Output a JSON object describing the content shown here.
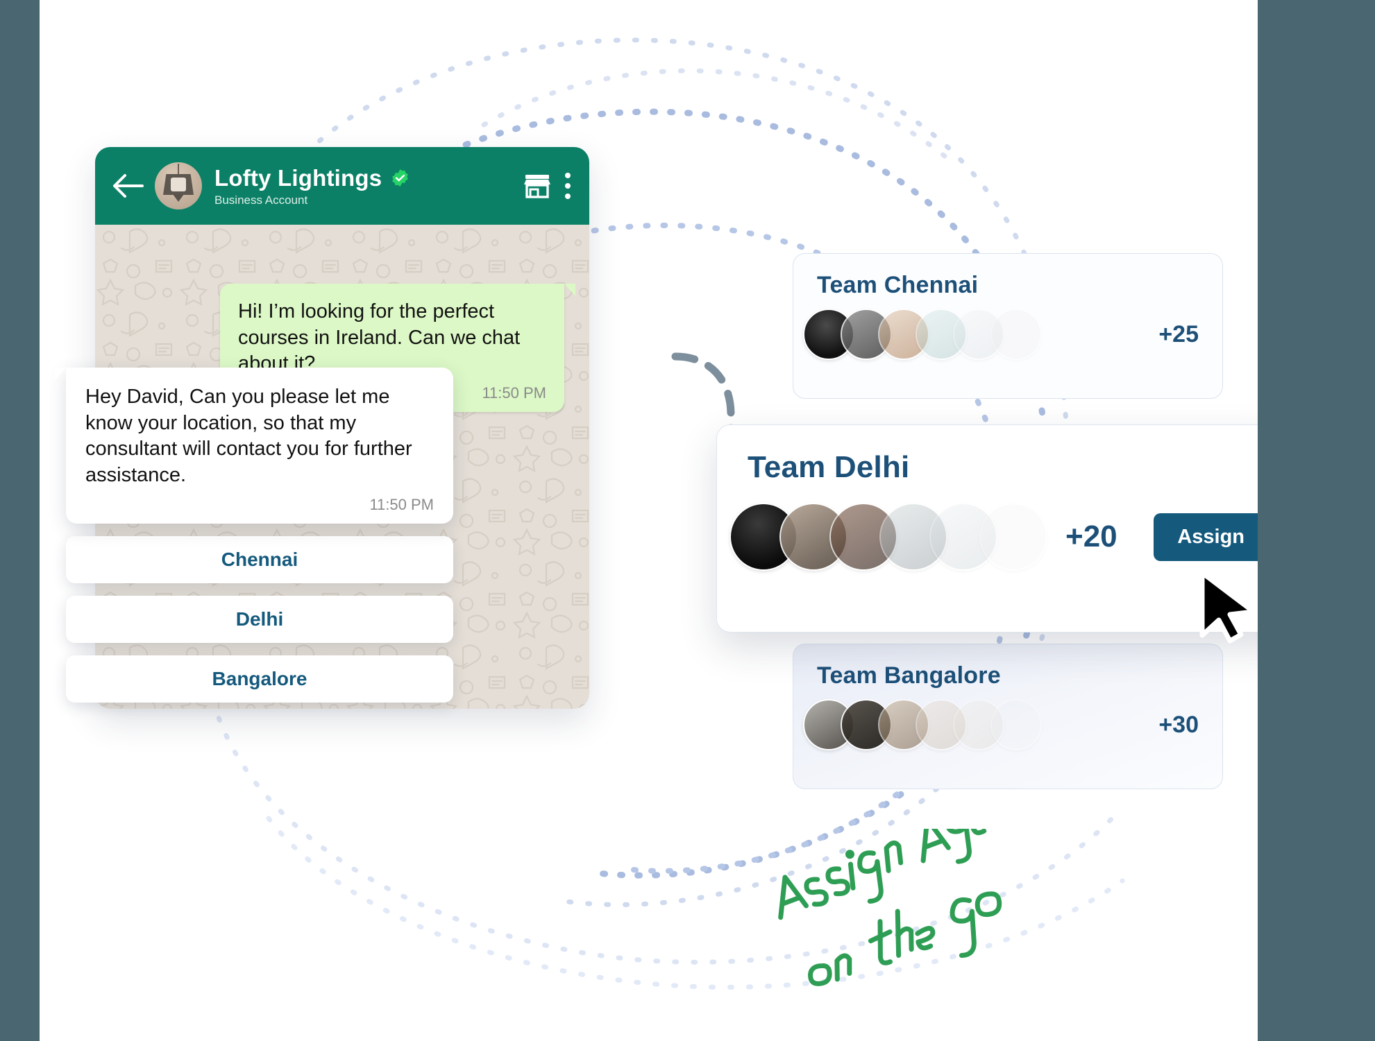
{
  "theme": {
    "page_background": "#4a6670",
    "panel_background": "#ffffff",
    "whatsapp_header_green": "#0c8066",
    "outgoing_bubble_green": "#dcf8c6",
    "chat_background": "#e4ded6",
    "accent_blue": "#155A7D",
    "title_blue": "#1d5078",
    "arc_blue": "#b9c8e4",
    "handwriting_green": "#2f9e55",
    "blob_navy": "#0d1a8c"
  },
  "chat": {
    "back_icon": "back-arrow-icon",
    "avatar_icon": "pendant-lamp-avatar",
    "title": "Lofty Lightings",
    "verified_icon": "verified-badge-icon",
    "subtitle": "Business Account",
    "store_icon": "storefront-icon",
    "menu_icon": "kebab-menu-icon",
    "messages": [
      {
        "direction": "outgoing",
        "text": "Hi! I’m looking for the perfect courses in Ireland. Can we chat about it?",
        "time": "11:50 PM"
      },
      {
        "direction": "incoming",
        "text": "Hey David, Can you please let me know your location, so that my consultant will contact you for further assistance.",
        "time": "11:50 PM"
      }
    ],
    "quick_replies": [
      {
        "label": "Chennai"
      },
      {
        "label": "Delhi"
      },
      {
        "label": "Bangalore"
      }
    ]
  },
  "teams": [
    {
      "name": "Team Chennai",
      "count": "+25",
      "state": "muted",
      "avatars": [
        "#1c1c1c",
        "#5f5c58",
        "#b08a6e",
        "#a9c2c4",
        "#cfd6d8",
        "#e2e2e2"
      ],
      "has_assign_button": false
    },
    {
      "name": "Team Delhi",
      "count": "+20",
      "state": "active",
      "avatars": [
        "#121212",
        "#6b6158",
        "#4d3a32",
        "#8f9498",
        "#c3ccd2",
        "#e8eaec"
      ],
      "has_assign_button": true,
      "assign_label": "Assign"
    },
    {
      "name": "Team Bangalore",
      "count": "+30",
      "state": "muted",
      "avatars": [
        "#7d7c78",
        "#2a2723",
        "#9d8874",
        "#d3c7bb",
        "#dedad4",
        "#eceef2"
      ],
      "has_assign_button": false
    }
  ],
  "cursor": {
    "icon": "mouse-pointer-icon"
  },
  "annotation": {
    "line1": "Assign Agents",
    "line2": "on the go"
  }
}
